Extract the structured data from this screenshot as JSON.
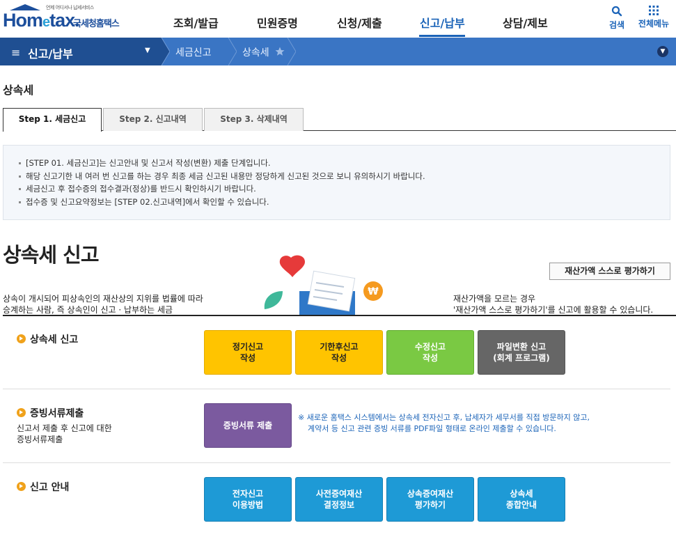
{
  "header": {
    "logo_tagline": "언제 어디서나 납세서비스",
    "logo_brand_a": "Hom",
    "logo_brand_e": "e",
    "logo_brand_b": "tax.",
    "logo_sub": "국세청홈택스",
    "menus": [
      "조회/발급",
      "민원증명",
      "신청/제출",
      "신고/납부",
      "상담/제보"
    ],
    "active_menu": "신고/납부",
    "search_label": "검색",
    "all_menu_label": "전체메뉴"
  },
  "navbar": {
    "first_label": "신고/납부",
    "crumbs": [
      "세금신고",
      "상속세"
    ]
  },
  "page_title": "상속세",
  "tabs": [
    "Step 1. 세금신고",
    "Step 2. 신고내역",
    "Step 3. 삭제내역"
  ],
  "notice": [
    "[STEP 01. 세금신고]는 신고안내 및 신고서 작성(변환) 제출 단계입니다.",
    "해당 신고기한 내 여러 번 신고를 하는 경우 최종 세금 신고된 내용만 정당하게 신고된 것으로 보니 유의하시기 바랍니다.",
    "세금신고 후 접수증의 접수결과(정상)를 반드시 확인하시기 바랍니다.",
    "접수증 및 신고요약정보는 [STEP 02.신고내역]에서 확인할 수 있습니다."
  ],
  "section": {
    "title": "상속세 신고",
    "eval_button": "재산가액 스스로 평가하기",
    "desc_left": [
      "상속이 개시되어 피상속인의 재산상의 지위를 법률에 따라",
      "승계하는 사람, 즉 상속인이 신고 · 납부하는 세금"
    ],
    "desc_right": [
      "재산가액을 모르는 경우",
      "'재산가액 스스로 평가하기'를 신고에 활용할 수 있습니다."
    ]
  },
  "rows": {
    "filing": {
      "title": "상속세 신고",
      "buttons": [
        "정기신고\n작성",
        "기한후신고\n작성",
        "수정신고\n작성",
        "파일변환 신고\n(회계 프로그램)"
      ]
    },
    "proof": {
      "title": "증빙서류제출",
      "sub": [
        "신고서 제출 후 신고에 대한",
        "증빙서류제출"
      ],
      "button": "증빙서류 제출",
      "note": [
        "※ 새로운 홈택스 시스템에서는 상속세 전자신고 후, 납세자가 세무서를 직접 방문하지 않고,",
        "계약서 등 신고 관련 증빙 서류를 PDF파일 형태로 온라인 제출할 수 있습니다."
      ]
    },
    "guide": {
      "title": "신고 안내",
      "buttons": [
        "전자신고\n이용방법",
        "사전증여재산\n결정정보",
        "상속증여재산\n평가하기",
        "상속세\n종합안내"
      ]
    }
  },
  "colors": {
    "brand": "#1d4f9c",
    "accent": "#1a63b8",
    "nav": "#3a75c4",
    "nav_dark": "#1f4f92",
    "yellow": "#ffc400",
    "green": "#7ac943",
    "gray": "#666666",
    "purple": "#7b5a9f",
    "blue": "#1e9ad6"
  }
}
